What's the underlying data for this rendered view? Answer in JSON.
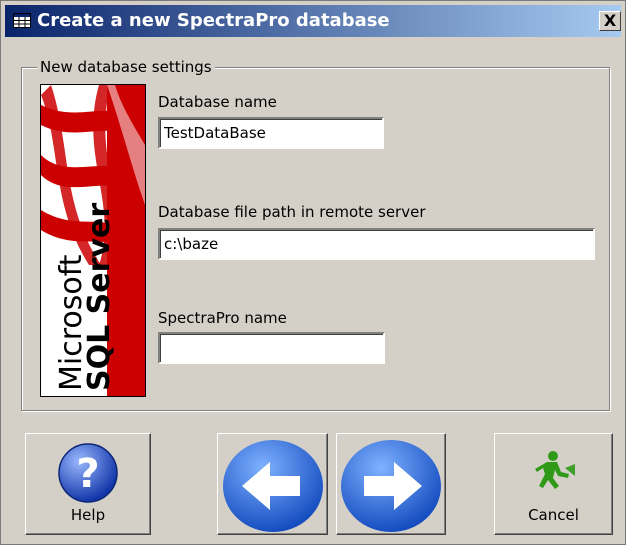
{
  "window": {
    "title": "Create a new SpectraPro database",
    "close_label": "X"
  },
  "group": {
    "legend": "New database settings",
    "logo_text_top": "Microsoft",
    "logo_text_bottom": "SQL Server"
  },
  "fields": {
    "db_name": {
      "label": "Database name",
      "value": "TestDataBase"
    },
    "db_path": {
      "label": "Database file path in remote server",
      "value": "c:\\baze"
    },
    "spectrapro_name": {
      "label": "SpectraPro name",
      "value": ""
    }
  },
  "buttons": {
    "help_label": "Help",
    "cancel_label": "Cancel"
  },
  "colors": {
    "title_start": "#0a246a",
    "title_end": "#a6caf0",
    "arrow_blue": "#1c5fd0",
    "logo_red": "#cc0000",
    "cancel_green": "#2e9a18"
  },
  "icons": [
    "table-icon",
    "microsoft-sql-server-logo",
    "help-icon",
    "back-arrow-icon",
    "forward-arrow-icon",
    "exit-icon"
  ]
}
